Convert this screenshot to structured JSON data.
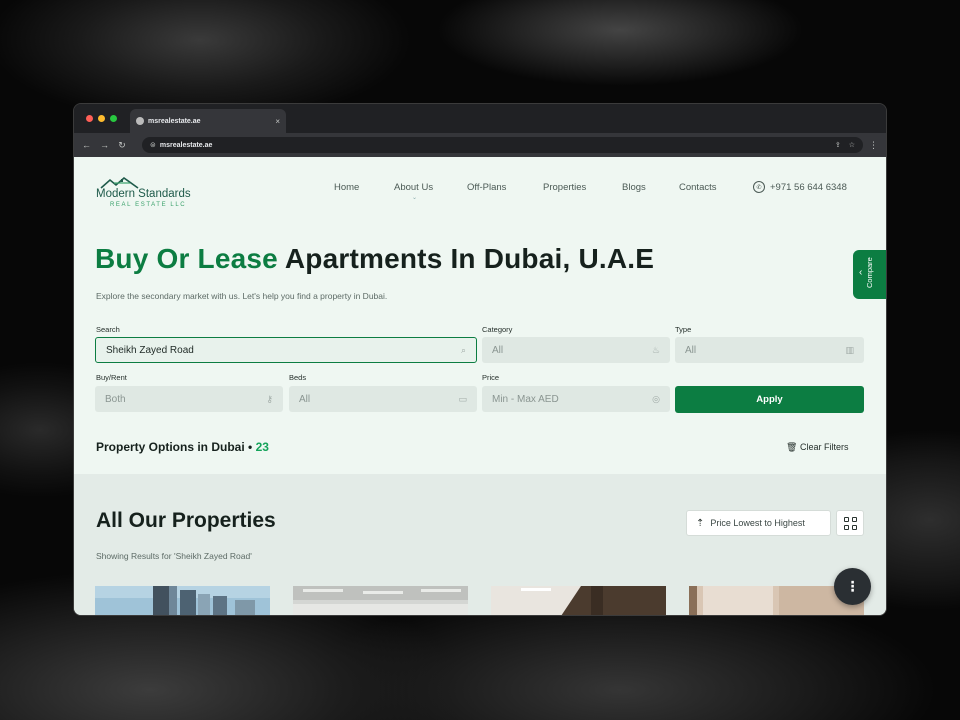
{
  "browser": {
    "tab_title": "msrealestate.ae",
    "tab_close": "×",
    "url": "msrealestate.ae"
  },
  "logo": {
    "brand": "Modern Standards",
    "sub": "REAL ESTATE LLC"
  },
  "nav": {
    "items": [
      "Home",
      "About Us",
      "Off-Plans",
      "Properties",
      "Blogs",
      "Contacts"
    ],
    "phone": "+971 56 644 6348"
  },
  "hero": {
    "title_accent": "Buy Or Lease",
    "title_rest": " Apartments In Dubai, U.A.E",
    "subtitle": "Explore the secondary market with us. Let's help you find a property in Dubai."
  },
  "filters": {
    "search": {
      "label": "Search",
      "value": "Sheikh Zayed Road"
    },
    "category": {
      "label": "Category",
      "value": "All"
    },
    "type": {
      "label": "Type",
      "value": "All"
    },
    "buy_rent": {
      "label": "Buy/Rent",
      "value": "Both"
    },
    "beds": {
      "label": "Beds",
      "value": "All"
    },
    "price": {
      "label": "Price",
      "value": "Min - Max AED"
    },
    "apply": "Apply"
  },
  "options": {
    "label": "Property Options in Dubai",
    "sep": " • ",
    "count": "23",
    "clear": "Clear Filters"
  },
  "compare": {
    "label": "Compare"
  },
  "listing": {
    "title": "All Our Properties",
    "subtitle": "Showing Results for 'Sheikh Zayed Road'",
    "sort_label": "Price Lowest to Highest"
  },
  "colors": {
    "accent": "#0c7d42",
    "count": "#14a35a",
    "page_bg": "#eff7f2"
  }
}
